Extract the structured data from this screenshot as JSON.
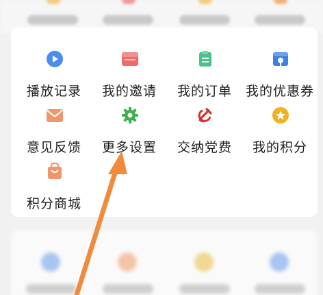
{
  "menu": {
    "items": [
      {
        "label": "播放记录",
        "icon": "play-icon",
        "color": "#4a8df0"
      },
      {
        "label": "我的邀请",
        "icon": "invite-icon",
        "color": "#ef6b6b"
      },
      {
        "label": "我的订单",
        "icon": "order-icon",
        "color": "#4bc08a"
      },
      {
        "label": "我的优惠券",
        "icon": "coupon-icon",
        "color": "#3f7fe6"
      },
      {
        "label": "意见反馈",
        "icon": "feedback-icon",
        "color": "#f2956a"
      },
      {
        "label": "更多设置",
        "icon": "gear-icon",
        "color": "#3fae4b"
      },
      {
        "label": "交纳党费",
        "icon": "party-emblem-icon",
        "color": "#d8302b"
      },
      {
        "label": "我的积分",
        "icon": "points-icon",
        "color": "#f2b21f"
      },
      {
        "label": "积分商城",
        "icon": "shopping-bag-icon",
        "color": "#f2956a"
      }
    ]
  },
  "annotation": {
    "arrow_color": "#f08a3c"
  }
}
